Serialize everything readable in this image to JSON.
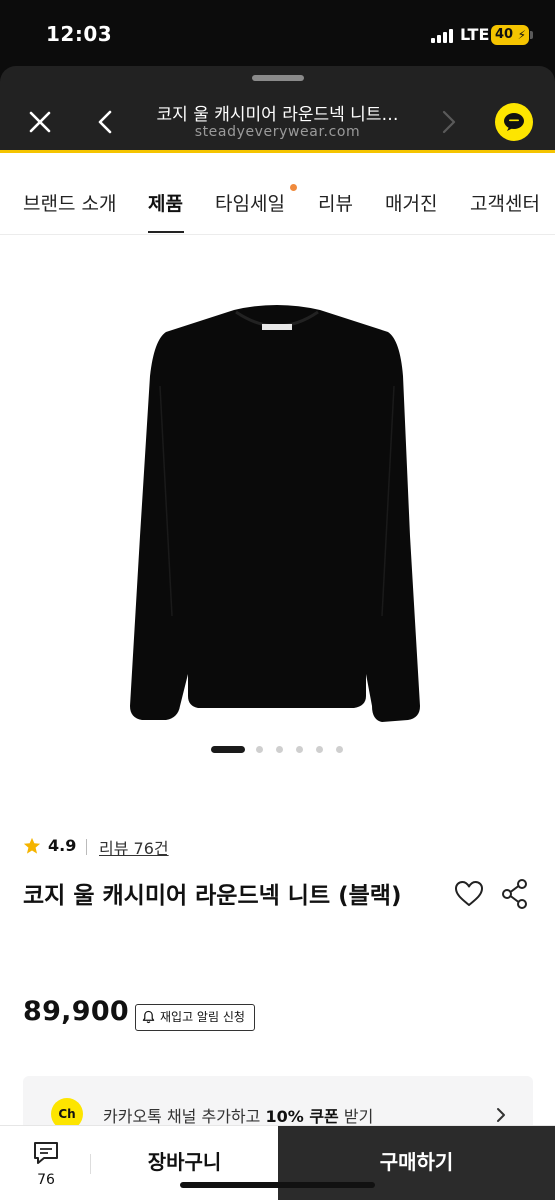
{
  "status_bar": {
    "time": "12:03",
    "network": "LTE",
    "battery": "40"
  },
  "browser": {
    "page_title": "코지 울 캐시미어 라운드넥 니트…",
    "url": "steadyeverywear.com",
    "icons": [
      "close-icon",
      "back-icon",
      "forward-icon",
      "kakao-chat-icon"
    ]
  },
  "nav": {
    "items": [
      {
        "label": "브랜드 소개"
      },
      {
        "label": "제품"
      },
      {
        "label": "타임세일"
      },
      {
        "label": "리뷰"
      },
      {
        "label": "매거진"
      },
      {
        "label": "고객센터"
      }
    ],
    "active_index": 1,
    "accent_dot_color": "#f08a3c"
  },
  "carousel": {
    "total": 6,
    "current": 1
  },
  "product": {
    "rating": "4.9",
    "review_link": "리뷰 76건",
    "name": "코지 울 캐시미어 라운드넥 니트 (블랙)",
    "price": "89,900",
    "restock_label": "재입고 알림 신청"
  },
  "coupon": {
    "badge": "Ch",
    "text_prefix": "카카오톡 채널 추가하고 ",
    "text_highlight": "10% 쿠폰",
    "text_suffix": " 받기"
  },
  "bottom_bar": {
    "review_count": "76",
    "cart_label": "장바구니",
    "buy_label": "구매하기"
  },
  "colors": {
    "accent_yellow": "#f5c400",
    "kakao_yellow": "#fde500",
    "buy_button": "#2b2b2b"
  }
}
